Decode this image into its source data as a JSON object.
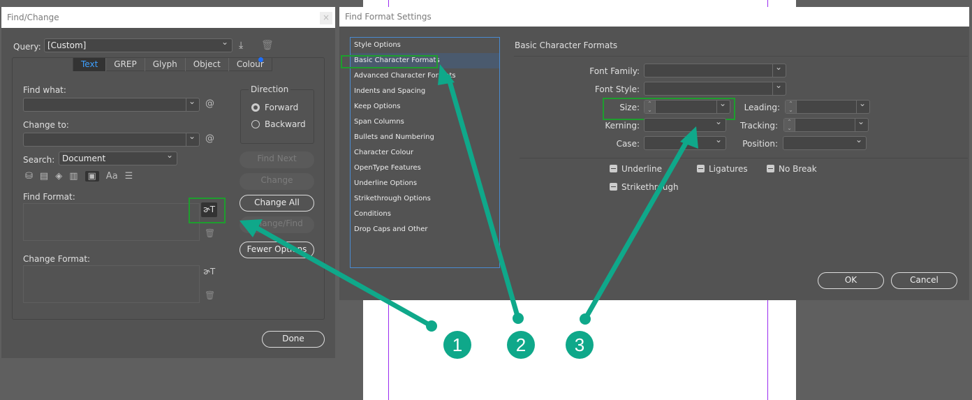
{
  "find_change": {
    "title": "Find/Change",
    "close": "×",
    "query_label": "Query:",
    "query_value": "[Custom]",
    "tabs": [
      "Text",
      "GREP",
      "Glyph",
      "Object",
      "Colour"
    ],
    "find_what_label": "Find what:",
    "change_to_label": "Change to:",
    "special_char_symbol": "@",
    "search_label": "Search:",
    "search_value": "Document",
    "option_icon_aa": "Aa",
    "direction_label": "Direction",
    "forward": "Forward",
    "backward": "Backward",
    "find_next": "Find Next",
    "change": "Change",
    "change_all": "Change All",
    "change_find": "Change/Find",
    "fewer_options": "Fewer Options",
    "find_format_label": "Find Format:",
    "change_format_label": "Change Format:",
    "done": "Done"
  },
  "find_format": {
    "title": "Find Format Settings",
    "categories": [
      "Style Options",
      "Basic Character Formats",
      "Advanced Character Formats",
      "Indents and Spacing",
      "Keep Options",
      "Span Columns",
      "Bullets and Numbering",
      "Character Colour",
      "OpenType Features",
      "Underline Options",
      "Strikethrough Options",
      "Conditions",
      "Drop Caps and Other"
    ],
    "selected_category": "Basic Character Formats",
    "section_title": "Basic Character Formats",
    "font_family": "Font Family:",
    "font_style": "Font Style:",
    "size": "Size:",
    "leading": "Leading:",
    "kerning": "Kerning:",
    "tracking": "Tracking:",
    "case": "Case:",
    "position": "Position:",
    "underline": "Underline",
    "ligatures": "Ligatures",
    "no_break": "No Break",
    "strikethrough": "Strikethrough",
    "ok": "OK",
    "cancel": "Cancel"
  },
  "callouts": [
    "1",
    "2",
    "3"
  ],
  "colors": {
    "accent_tab": "#3ea0ff",
    "callout": "#0fa88a",
    "highlight": "#1e9e2e"
  }
}
